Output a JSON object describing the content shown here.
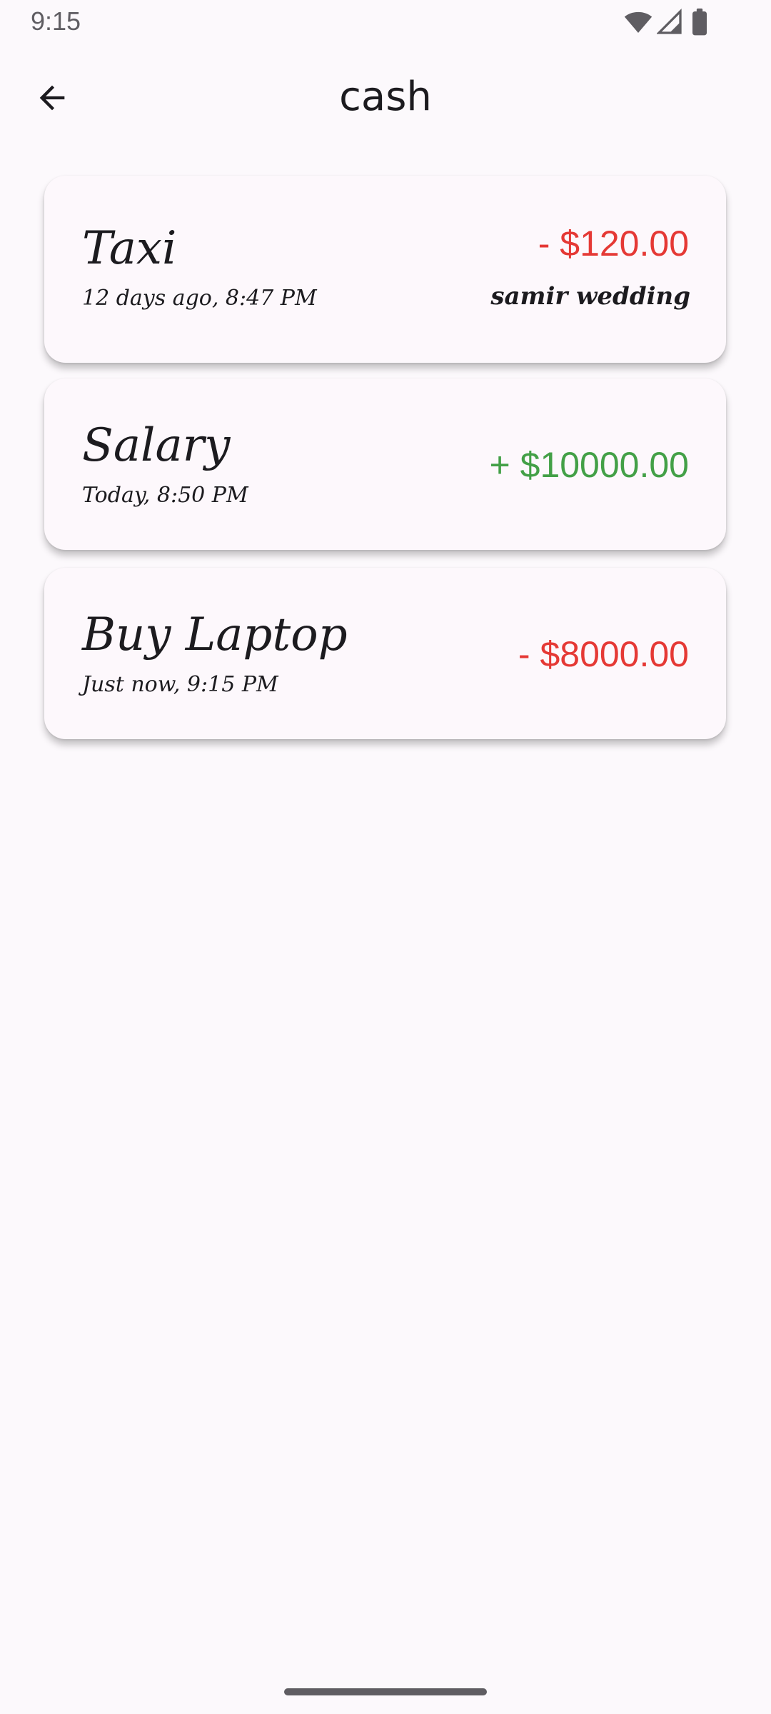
{
  "status_bar": {
    "time": "9:15",
    "icons": [
      "wifi-icon",
      "cellular-signal-icon",
      "battery-icon"
    ]
  },
  "app_bar": {
    "back_icon": "arrow-back-icon",
    "title": "cash"
  },
  "transactions": [
    {
      "title": "Taxi",
      "date": "12 days ago, 8:47 PM",
      "amount": "- $120.00",
      "type": "expense",
      "note": "samir wedding"
    },
    {
      "title": "Salary",
      "date": "Today, 8:50 PM",
      "amount": "+ $10000.00",
      "type": "income",
      "note": ""
    },
    {
      "title": "Buy Laptop",
      "date": "Just now, 9:15 PM",
      "amount": "- $8000.00",
      "type": "expense",
      "note": ""
    }
  ],
  "colors": {
    "expense": "#e53935",
    "income": "#43a047",
    "background": "#fcf9fc",
    "card": "#fdf8fc",
    "text": "#1c1b1f"
  }
}
